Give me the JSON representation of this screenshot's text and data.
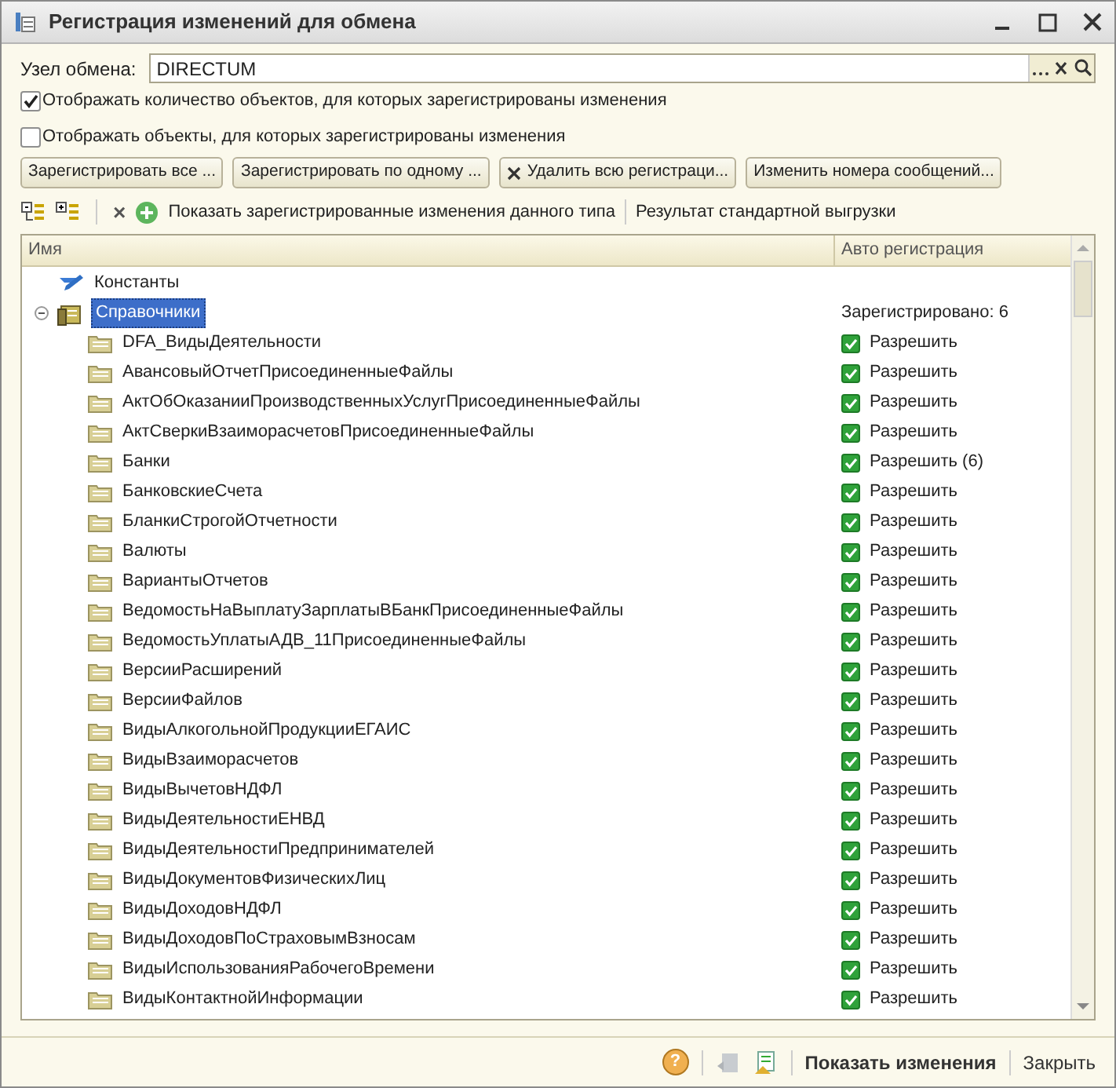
{
  "window": {
    "title": "Регистрация изменений для обмена"
  },
  "node_field": {
    "label": "Узел обмена:",
    "value": "DIRECTUM"
  },
  "options": [
    {
      "label": "Отображать количество объектов, для которых зарегистрированы изменения",
      "checked": true
    },
    {
      "label": "Отображать объекты, для которых зарегистрированы изменения",
      "checked": false
    }
  ],
  "buttons": [
    {
      "label": "Зарегистрировать все ...",
      "kind": "plain"
    },
    {
      "label": "Зарегистрировать по одному ...",
      "kind": "plain"
    },
    {
      "label": "Удалить всю регистраци...",
      "kind": "delete"
    },
    {
      "label": "Изменить номера сообщений...",
      "kind": "plain"
    }
  ],
  "toolbar": {
    "delete_glyph": "×",
    "show_changes": "Показать зарегистрированные изменения данного типа",
    "result": "Результат стандартной выгрузки"
  },
  "table": {
    "columns": [
      "Имя",
      "Авто регистрация"
    ],
    "rows": [
      {
        "name": "Константы",
        "kind": "constants",
        "selected": false
      },
      {
        "name": "Справочники",
        "kind": "catalogs",
        "selected": true,
        "expanded": true,
        "status": "Зарегистрировано: 6",
        "children": [
          {
            "name": "DFA_ВидыДеятельности",
            "auto": "Разрешить",
            "checked": true
          },
          {
            "name": "АвансовыйОтчетПрисоединенныеФайлы",
            "auto": "Разрешить",
            "checked": true
          },
          {
            "name": "АктОбОказанииПроизводственныхУслугПрисоединенныеФайлы",
            "auto": "Разрешить",
            "checked": true
          },
          {
            "name": "АктСверкиВзаиморасчетовПрисоединенныеФайлы",
            "auto": "Разрешить",
            "checked": true
          },
          {
            "name": "Банки",
            "auto": "Разрешить (6)",
            "checked": true
          },
          {
            "name": "БанковскиеСчета",
            "auto": "Разрешить",
            "checked": true
          },
          {
            "name": "БланкиСтрогойОтчетности",
            "auto": "Разрешить",
            "checked": true
          },
          {
            "name": "Валюты",
            "auto": "Разрешить",
            "checked": true
          },
          {
            "name": "ВариантыОтчетов",
            "auto": "Разрешить",
            "checked": true
          },
          {
            "name": "ВедомостьНаВыплатуЗарплатыВБанкПрисоединенныеФайлы",
            "auto": "Разрешить",
            "checked": true
          },
          {
            "name": "ВедомостьУплатыАДВ_11ПрисоединенныеФайлы",
            "auto": "Разрешить",
            "checked": true
          },
          {
            "name": "ВерсииРасширений",
            "auto": "Разрешить",
            "checked": true
          },
          {
            "name": "ВерсииФайлов",
            "auto": "Разрешить",
            "checked": true
          },
          {
            "name": "ВидыАлкогольнойПродукцииЕГАИС",
            "auto": "Разрешить",
            "checked": true
          },
          {
            "name": "ВидыВзаиморасчетов",
            "auto": "Разрешить",
            "checked": true
          },
          {
            "name": "ВидыВычетовНДФЛ",
            "auto": "Разрешить",
            "checked": true
          },
          {
            "name": "ВидыДеятельностиЕНВД",
            "auto": "Разрешить",
            "checked": true
          },
          {
            "name": "ВидыДеятельностиПредпринимателей",
            "auto": "Разрешить",
            "checked": true
          },
          {
            "name": "ВидыДокументовФизическихЛиц",
            "auto": "Разрешить",
            "checked": true
          },
          {
            "name": "ВидыДоходовНДФЛ",
            "auto": "Разрешить",
            "checked": true
          },
          {
            "name": "ВидыДоходовПоСтраховымВзносам",
            "auto": "Разрешить",
            "checked": true
          },
          {
            "name": "ВидыИспользованияРабочегоВремени",
            "auto": "Разрешить",
            "checked": true
          },
          {
            "name": "ВидыКонтактнойИнформации",
            "auto": "Разрешить",
            "checked": true
          }
        ]
      }
    ]
  },
  "footer": {
    "help_glyph": "?",
    "primary": "Показать изменения",
    "close": "Закрыть"
  }
}
